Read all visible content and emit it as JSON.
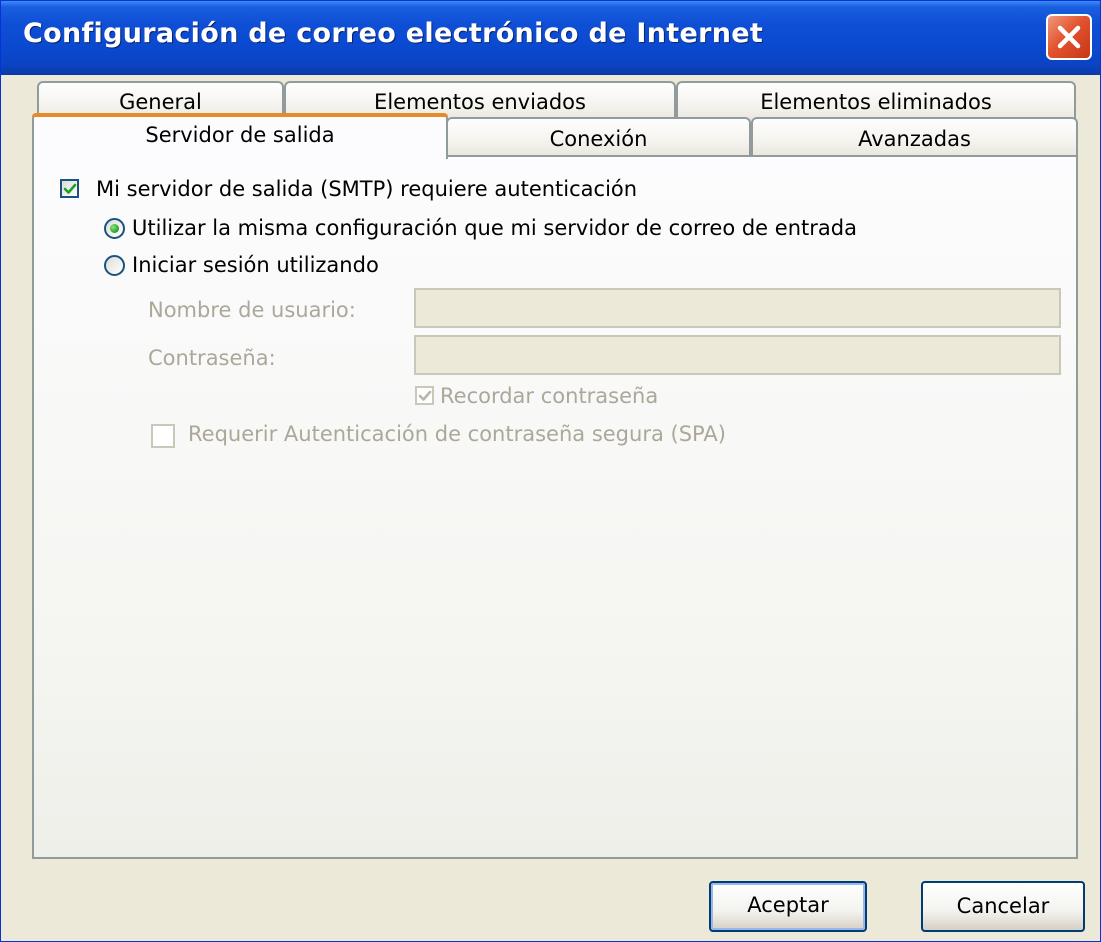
{
  "window": {
    "title": "Configuración de correo electrónico de Internet"
  },
  "tabs": {
    "general": "General",
    "sent_items": "Elementos enviados",
    "deleted_items": "Elementos eliminados",
    "outgoing_server": "Servidor de salida",
    "connection": "Conexión",
    "advanced": "Avanzadas",
    "active": "Servidor de salida"
  },
  "panel": {
    "smtp_auth_checkbox": {
      "label": "Mi servidor de salida (SMTP) requiere autenticación",
      "checked": true
    },
    "same_settings_radio": {
      "label": "Utilizar la misma configuración que mi servidor de correo de entrada",
      "selected": true
    },
    "login_using_radio": {
      "label": "Iniciar sesión utilizando",
      "selected": false
    },
    "username": {
      "label": "Nombre de usuario:",
      "value": "",
      "enabled": false
    },
    "password": {
      "label": "Contraseña:",
      "value": "",
      "enabled": false
    },
    "remember_password": {
      "label": "Recordar contraseña",
      "checked": true,
      "enabled": false
    },
    "spa": {
      "label": "Requerir Autenticación de contraseña segura (SPA)",
      "checked": false,
      "enabled": false
    }
  },
  "buttons": {
    "ok": "Aceptar",
    "cancel": "Cancelar"
  },
  "icons": {
    "close": "close-icon",
    "check": "checkmark-icon"
  },
  "colors": {
    "titlebar": "#0a49d0",
    "close_button": "#e2542f",
    "active_tab_accent": "#e68b2c",
    "dialog_background": "#ece9d8",
    "checkmark": "#21a121",
    "disabled_text": "#aca899"
  }
}
